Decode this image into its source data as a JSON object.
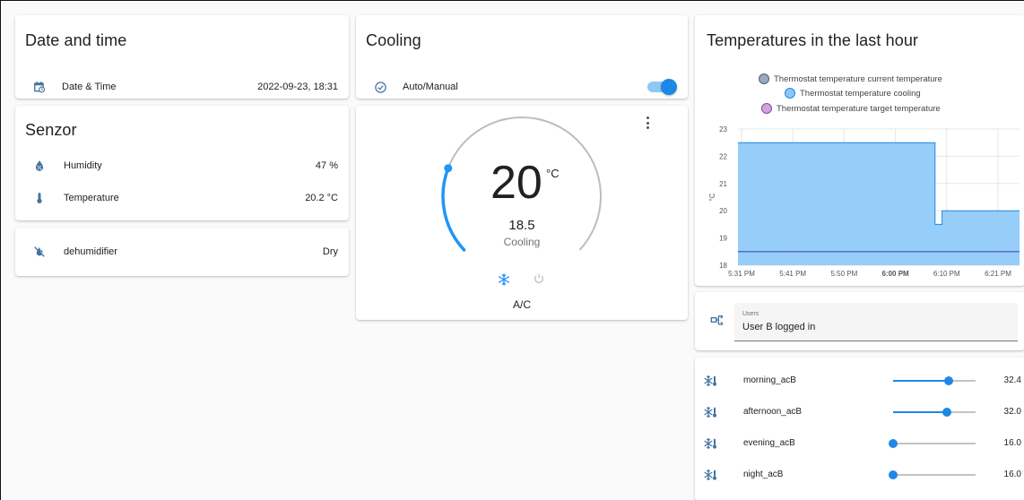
{
  "datetime_card": {
    "title": "Date and time",
    "row": {
      "label": "Date & Time",
      "value": "2022-09-23, 18:31",
      "icon": "calendar-clock-icon"
    }
  },
  "sensor_card": {
    "title": "Senzor",
    "rows": [
      {
        "label": "Humidity",
        "value": "47 %",
        "icon": "water-percent-icon"
      },
      {
        "label": "Temperature",
        "value": "20.2 °C",
        "icon": "thermometer-icon"
      }
    ]
  },
  "dehumidifier_card": {
    "label": "dehumidifier",
    "value": "Dry",
    "icon": "water-off-icon"
  },
  "cooling_card": {
    "title": "Cooling",
    "row": {
      "label": "Auto/Manual",
      "icon": "check-circle-outline-icon",
      "toggle_on": true
    }
  },
  "thermostat_card": {
    "target": "20",
    "unit": "°C",
    "current": "18.5",
    "action": "Cooling",
    "mode": "A/C",
    "arc_current_fraction": 0.24,
    "colors": {
      "arc": "#bdbdbd",
      "active": "#2196f3"
    }
  },
  "history_card": {
    "title": "Temperatures in the last hour",
    "legend": [
      {
        "name": "Thermostat temperature current temperature",
        "fill": "#9aa9bd",
        "stroke": "#4a6080"
      },
      {
        "name": "Thermostat temperature cooling",
        "fill": "#8cc7f5",
        "stroke": "#1e88e5"
      },
      {
        "name": "Thermostat temperature target temperature",
        "fill": "#cfa6d9",
        "stroke": "#8e44ad"
      }
    ]
  },
  "chart_data": {
    "type": "area",
    "ylabel": "°C",
    "ylim": [
      18,
      23
    ],
    "yticks": [
      "18",
      "19",
      "20",
      "21",
      "22",
      "23"
    ],
    "xticks": [
      "5:31 PM",
      "5:41 PM",
      "5:50 PM",
      "6:00 PM",
      "6:10 PM",
      "6:21 PM"
    ],
    "xrange_minutes": [
      0,
      60
    ],
    "series": [
      {
        "name": "Thermostat temperature cooling",
        "points": [
          [
            0,
            22.5
          ],
          [
            42,
            22.5
          ],
          [
            42,
            19.5
          ],
          [
            43.5,
            19.5
          ],
          [
            43.5,
            20
          ],
          [
            60,
            20
          ]
        ]
      },
      {
        "name": "Thermostat temperature current temperature",
        "points": [
          [
            0,
            18.5
          ],
          [
            60,
            18.5
          ]
        ]
      }
    ]
  },
  "users_card": {
    "icon": "account-switch-icon",
    "field_label": "Users",
    "field_value": "User B logged in"
  },
  "sliders_card": {
    "items": [
      {
        "label": "morning_acB",
        "value": "32.4",
        "fraction": 0.67,
        "icon": "snowflake-thermometer-icon"
      },
      {
        "label": "afternoon_acB",
        "value": "32.0",
        "fraction": 0.65,
        "icon": "snowflake-thermometer-icon"
      },
      {
        "label": "evening_acB",
        "value": "16.0",
        "fraction": 0.0,
        "icon": "snowflake-thermometer-icon"
      },
      {
        "label": "night_acB",
        "value": "16.0",
        "fraction": 0.0,
        "icon": "snowflake-thermometer-icon"
      }
    ]
  }
}
